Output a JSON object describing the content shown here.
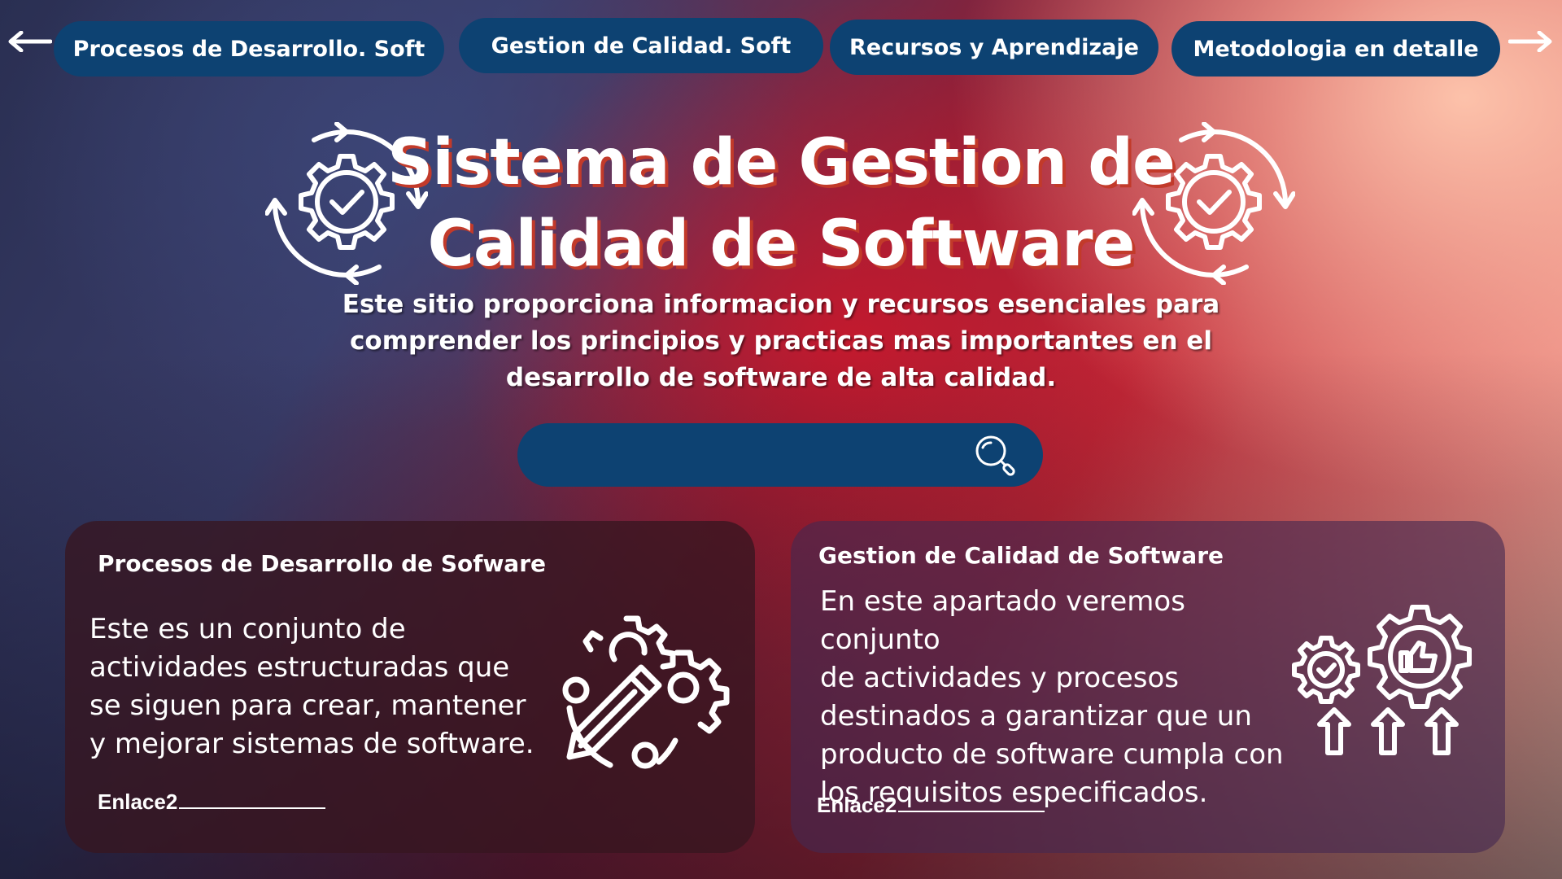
{
  "nav": {
    "buttons": [
      "Procesos de Desarrollo. Soft",
      "Gestion de Calidad. Soft",
      "Recursos y Aprendizaje",
      "Metodologia en detalle"
    ]
  },
  "hero": {
    "title_line1": "Sistema de Gestion de",
    "title_line2": "Calidad de Software",
    "subtitle_line1": "Este sitio proporciona informacion y recursos esenciales  para",
    "subtitle_line2": "comprender los principios y practicas mas importantes en el",
    "subtitle_line3": "desarrollo de software de alta calidad."
  },
  "search": {
    "placeholder": ""
  },
  "cards": [
    {
      "heading": "Procesos de Desarrollo de Sofware",
      "lines": [
        "Este es un conjunto de",
        "actividades estructuradas que",
        "se siguen para crear, mantener",
        "y mejorar sistemas de software."
      ],
      "link": "Enlace2"
    },
    {
      "heading": "Gestion de Calidad de Software",
      "lines": [
        "En este apartado veremos conjunto",
        "de actividades y procesos",
        "destinados a garantizar que un",
        "producto de software cumpla con",
        "los requisitos especificados."
      ],
      "link": "Enlace2"
    }
  ],
  "colors": {
    "button_bg": "#0d4272",
    "title_shadow": "#c23a2a",
    "text": "#ffffff"
  },
  "icons": [
    "arrow-left-icon",
    "arrow-right-icon",
    "gear-check-icon",
    "search-icon",
    "gears-pencil-icon",
    "gears-thumbs-up-icon",
    "arrow-up-icon"
  ]
}
